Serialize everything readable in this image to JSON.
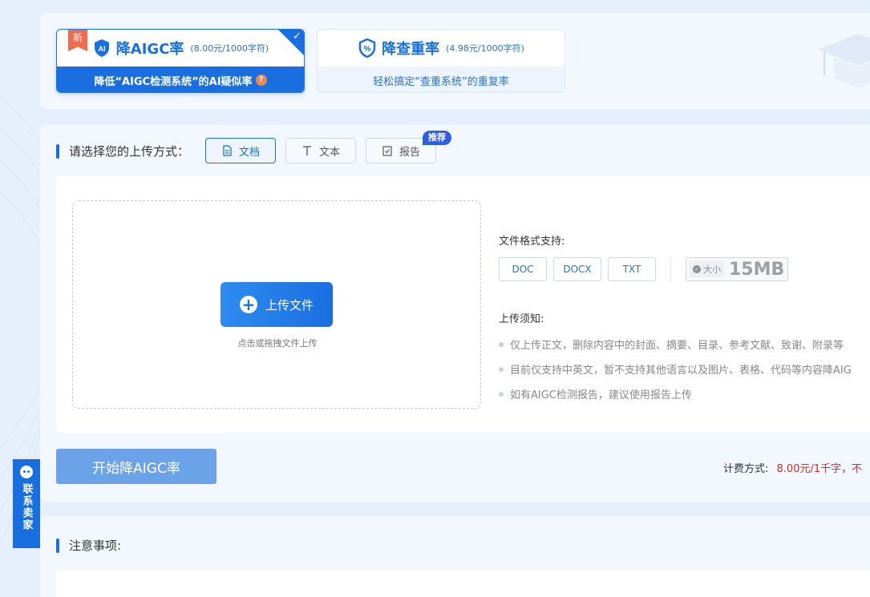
{
  "services": [
    {
      "badge": "新",
      "name": "降AIGC率",
      "price": "(8.00元/1000字符)",
      "desc": "降低“AIGC检测系统”的AI疑似率",
      "icon": "ai-shield-icon",
      "selected": true
    },
    {
      "name": "降查重率",
      "price": "(4.98元/1000字符)",
      "desc": "轻松搞定“查重系统”的重复率",
      "icon": "percent-shield-icon",
      "selected": false
    }
  ],
  "upload": {
    "section_title": "请选择您的上传方式：",
    "tabs": [
      {
        "label": "文档",
        "icon": "document-icon",
        "active": true
      },
      {
        "label": "文本",
        "icon": "text-icon",
        "active": false
      },
      {
        "label": "报告",
        "icon": "report-icon",
        "active": false,
        "tag": "推荐"
      }
    ],
    "button_label": "上传文件",
    "drop_hint": "点击或拖拽文件上传",
    "format_label": "文件格式支持:",
    "formats": [
      "DOC",
      "DOCX",
      "TXT"
    ],
    "size_label": "大小",
    "size_value": "15MB",
    "notice_title": "上传须知:",
    "notices": [
      "仅上传正文，删除内容中的封面、摘要、目录、参考文献、致谢、附录等",
      "目前仅支持中英文，暂不支持其他语言以及图片、表格、代码等内容降AIG",
      "如有AIGC检测报告，建议使用报告上传"
    ]
  },
  "actions": {
    "start_label": "开始降AIGC率",
    "billing_label": "计费方式:",
    "billing_value": "8.00元/1千字，不"
  },
  "notes": {
    "title": "注意事项:"
  },
  "contact": {
    "label": "联系卖家"
  },
  "colors": {
    "primary": "#1a6fe0",
    "new_badge": "#f36b4f",
    "price_red": "#d9281e",
    "start_button": "#6ca3e8"
  }
}
